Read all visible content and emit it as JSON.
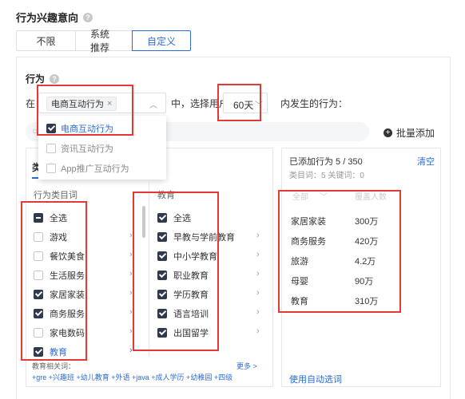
{
  "header": {
    "title": "行为兴趣意向"
  },
  "segments": [
    {
      "label": "不限"
    },
    {
      "label": "系统推荐"
    },
    {
      "label": "自定义",
      "active": true
    }
  ],
  "behavior": {
    "title": "行为",
    "in_label": "在",
    "selected_tag": "电商互动行为",
    "mid_text": "中，选择用户",
    "days_value": "60天",
    "after_text": "内发生的行为：",
    "bulk_add": "批量添加",
    "dropdown_options": [
      {
        "label": "电商互动行为",
        "checked": true
      },
      {
        "label": "资讯互动行为",
        "checked": false
      },
      {
        "label": "App推广互动行为",
        "checked": false
      }
    ]
  },
  "category_list": {
    "tab_label": "类",
    "col1_header": "行为类目词",
    "col2_header": "教育",
    "left_items": [
      {
        "label": "全选",
        "state": "partial",
        "arrow": false
      },
      {
        "label": "游戏",
        "state": "unchecked",
        "arrow": true
      },
      {
        "label": "餐饮美食",
        "state": "unchecked",
        "arrow": true
      },
      {
        "label": "生活服务",
        "state": "unchecked",
        "arrow": true
      },
      {
        "label": "家居家装",
        "state": "checked",
        "arrow": true
      },
      {
        "label": "商务服务",
        "state": "checked",
        "arrow": true
      },
      {
        "label": "家电数码",
        "state": "unchecked",
        "arrow": true
      },
      {
        "label": "教育",
        "state": "checked",
        "arrow": true,
        "highlight": true
      }
    ],
    "right_items": [
      {
        "label": "全选",
        "state": "checked",
        "arrow": false
      },
      {
        "label": "早教与学前教育",
        "state": "checked",
        "arrow": true
      },
      {
        "label": "中小学教育",
        "state": "checked",
        "arrow": true
      },
      {
        "label": "职业教育",
        "state": "checked",
        "arrow": true
      },
      {
        "label": "学历教育",
        "state": "checked",
        "arrow": true
      },
      {
        "label": "语言培训",
        "state": "checked",
        "arrow": true
      },
      {
        "label": "出国留学",
        "state": "checked",
        "arrow": true
      }
    ],
    "related": {
      "title": "教育相关词：",
      "more": "更多 >",
      "tags": "+gre +兴趣班 +幼儿教育 +外语 +java +成人学历 +幼稚园 +四级"
    }
  },
  "added_panel": {
    "title": "已添加行为 5 / 350",
    "clear": "清空",
    "subtitle": "类目词：5   关键词：0",
    "faded_col1": "全部",
    "faded_col2": "覆盖人数",
    "items": [
      {
        "name": "家居家装",
        "value": "300万"
      },
      {
        "name": "商务服务",
        "value": "420万"
      },
      {
        "name": "旅游",
        "value": "4.2万"
      },
      {
        "name": "母婴",
        "value": "90万"
      },
      {
        "name": "教育",
        "value": "310万"
      }
    ],
    "auto_link": "使用自动选词"
  }
}
